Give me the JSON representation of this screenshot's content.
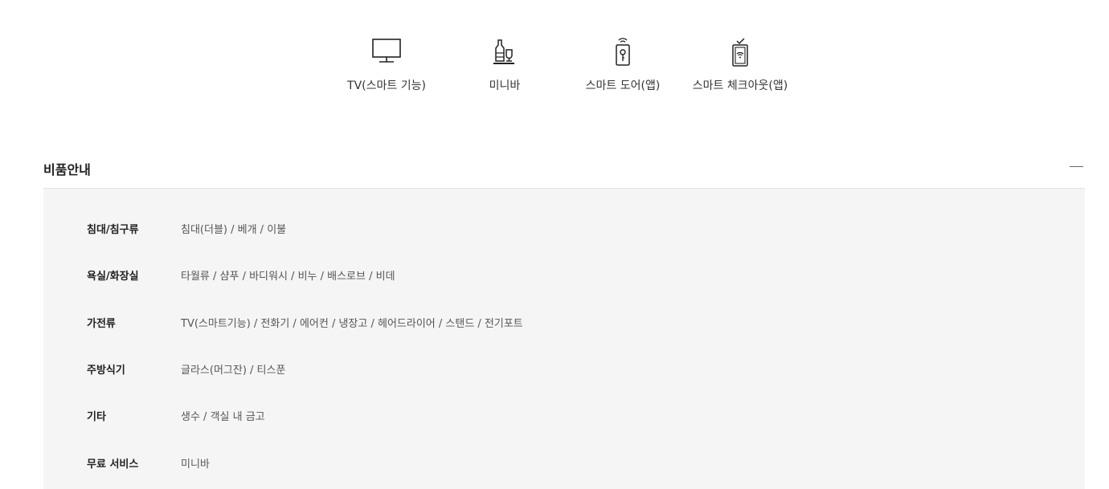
{
  "amenities": [
    {
      "label": "TV(스마트 기능)",
      "icon": "tv-icon"
    },
    {
      "label": "미니바",
      "icon": "minibar-icon"
    },
    {
      "label": "스마트 도어(앱)",
      "icon": "smart-door-icon"
    },
    {
      "label": "스마트 체크아웃(앱)",
      "icon": "smart-checkout-icon"
    }
  ],
  "section": {
    "title": "비품안내"
  },
  "rows": [
    {
      "category": "침대/침구류",
      "items": "침대(더블) / 베개 / 이불"
    },
    {
      "category": "욕실/화장실",
      "items": "타월류 / 샴푸 / 바디워시 / 비누 / 배스로브 / 비데"
    },
    {
      "category": "가전류",
      "items": "TV(스마트기능) / 전화기 / 에어컨 / 냉장고 / 헤어드라이어 / 스탠드 / 전기포트"
    },
    {
      "category": "주방식기",
      "items": "글라스(머그잔) / 티스푼"
    },
    {
      "category": "기타",
      "items": "생수 / 객실 내 금고"
    },
    {
      "category": "무료 서비스",
      "items": "미니바"
    }
  ]
}
